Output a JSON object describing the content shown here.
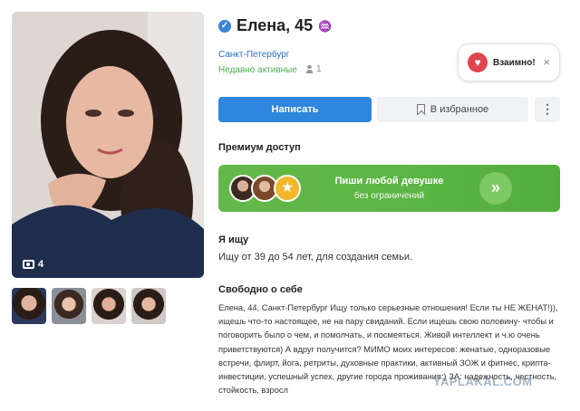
{
  "profile": {
    "name_age": "Елена, 45",
    "zodiac_symbol": "♒",
    "city": "Санкт-Петербург",
    "activity": "Недавно активные",
    "views_count": "1",
    "photo_count": "4"
  },
  "mutual": {
    "label": "Взаимно!",
    "close": "×"
  },
  "actions": {
    "write": "Написать",
    "favorite": "В избранное",
    "more": "⋮"
  },
  "premium": {
    "title": "Премиум доступ",
    "line1": "Пиши любой девушке",
    "line2": "без ограничений",
    "arrow": "»"
  },
  "seeking": {
    "title": "Я ищу",
    "text": "Ищу от 39 до 54 лет, для создания семьи."
  },
  "about": {
    "title": "Свободно о себе",
    "text": "Елена, 44, Санкт-Петербург Ищу только серьезные отношения! Если ты НЕ ЖЕНАТ!)), ищешь что-то настоящее, не на пару свиданий. Если ищешь свою половину- чтобы и поговорить было о чем, и помолчать, и посмеяться. Живой интеллект и ч.ю очень приветствуются) А вдруг получится? МИМО моих интересов: женатые, одноразовые встречи, флирт, йога, ретриты, духовные практики, активный ЗОЖ и фитнес, крипта-инвестиции, успешный успех, другие города проживания:) ЗА: надежность, честность, стойкость, взросл"
  },
  "watermark": "YAPLAKAL.COM",
  "colors": {
    "accent_blue": "#2e86de",
    "link_blue": "#2a6fc9",
    "online_green": "#4cae4c",
    "premium_green": "#5bb545",
    "heart_red": "#e0444f",
    "star_gold": "#f3b72c"
  },
  "icons": {
    "verified": "checkmark-badge-icon",
    "views": "person-icon",
    "camera": "camera-icon",
    "favorite": "bookmark-icon",
    "mutual": "heart-icon",
    "premium_badge": "star-icon"
  }
}
